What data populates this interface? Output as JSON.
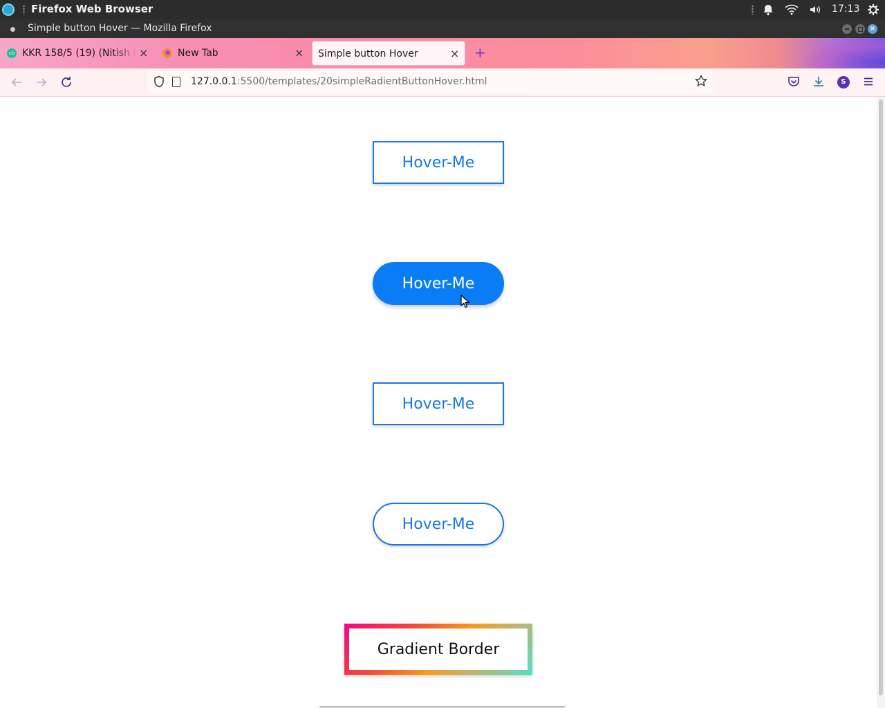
{
  "system_panel": {
    "app_name": "Firefox Web Browser",
    "clock": "17:13",
    "icons": [
      "notification-bell-icon",
      "wifi-icon",
      "volume-icon",
      "settings-gear-icon"
    ]
  },
  "window": {
    "title": "Simple button Hover — Mozilla Firefox"
  },
  "tabs": [
    {
      "label": "KKR 158/5 (19) (Nitish Rana",
      "favicon": "cricbuzz-icon",
      "favicon_text": "cb"
    },
    {
      "label": "New Tab",
      "favicon": "firefox-icon"
    },
    {
      "label": "Simple button Hover",
      "active": true
    }
  ],
  "url": {
    "host": "127.0.0.1",
    "rest": ":5500/templates/20simpleRadientButtonHover.html"
  },
  "profile": {
    "initial": "S"
  },
  "buttons": [
    {
      "label": "Hover-Me",
      "style": "square-outline"
    },
    {
      "label": "Hover-Me",
      "style": "pill-filled",
      "state": "hovered"
    },
    {
      "label": "Hover-Me",
      "style": "square-outline"
    },
    {
      "label": "Hover-Me",
      "style": "pill-outline"
    }
  ],
  "gradient_button": {
    "label": "Gradient Border"
  },
  "colors": {
    "accent_blue": "#1677e6",
    "hover_fill": "#0a7cf5",
    "gradient": [
      "#f5067f",
      "#f24a36",
      "#f89b1a",
      "#4fe0c9"
    ]
  }
}
